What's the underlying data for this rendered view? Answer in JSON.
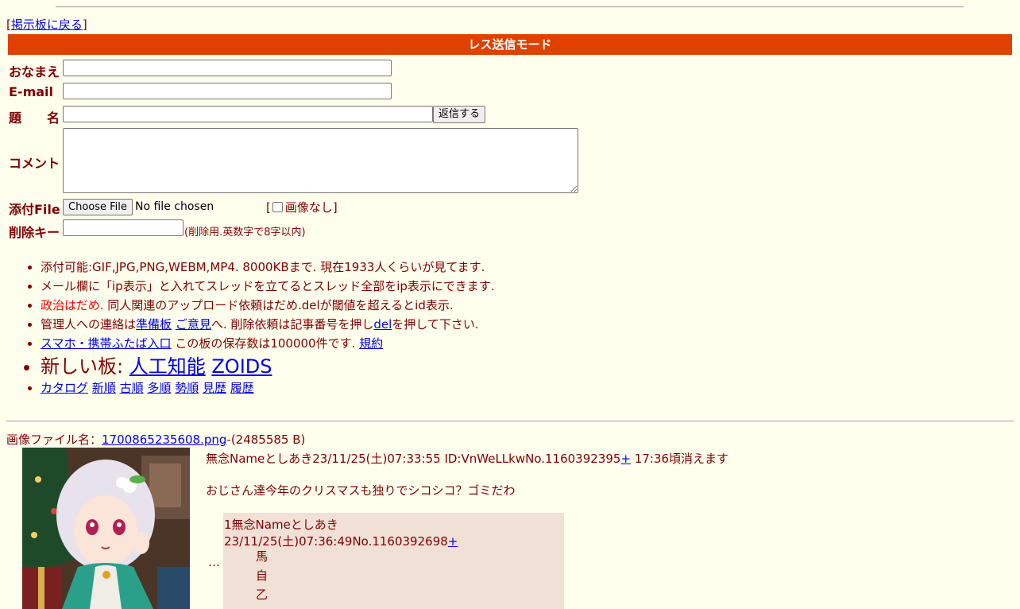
{
  "nav": {
    "back_open": "[",
    "back_label": "掲示板に戻る",
    "back_close": "]"
  },
  "form": {
    "mode_title": "レス送信モード",
    "name_label": "おなまえ",
    "email_label": "E-mail",
    "subject_label": "題　　名",
    "submit_label": "返信する",
    "comment_label": "コメント",
    "file_label": "添付File",
    "file_button": "Choose File",
    "file_status": "No file chosen",
    "noimage_open": "[",
    "noimage_label": "画像なし",
    "noimage_close": "]",
    "delkey_label": "削除キー",
    "delkey_hint": "(削除用.英数字で8字以内)"
  },
  "rules": {
    "r1": "添付可能:GIF,JPG,PNG,WEBM,MP4. 8000KBまで. 現在1933人くらいが見てます.",
    "r2": "メール欄に「ip表示」と入れてスレッドを立てるとスレッド全部をip表示にできます.",
    "r3_red": "政治はだめ.",
    "r3_rest": " 同人関連のアップロード依頼はだめ.delが閾値を超えるとid表示.",
    "r4_a": "管理人への連絡は",
    "r4_link1": "準備板",
    "r4_link2": "ご意見",
    "r4_b": "へ. 削除依頼は記事番号を押し",
    "r4_link3": "del",
    "r4_c": "を押して下さい.",
    "r5_link": "スマホ・携帯ふたば入口",
    "r5_text": " この板の保存数は100000件です.",
    "r5_link2": "規約",
    "r6_text": "新しい板: ",
    "r6_link1": "人工知能",
    "r6_link2": "ZOIDS",
    "sort_links": [
      "カタログ",
      "新順",
      "古順",
      "多順",
      "勢順",
      "見歴",
      "履歴"
    ]
  },
  "thread": {
    "file_prefix": "画像ファイル名：",
    "file_name": "1700865235608.png",
    "file_size": "-(2485585 B)",
    "op_header": "無念Nameとしあき23/11/25(土)07:33:55 ID:VnWeLLkwNo.1160392395",
    "op_plus": "+",
    "op_expire": " 17:36頃消えます",
    "op_body": "おじさん達今年のクリスマスも独りでシコシコ？ゴミだわ",
    "ellipsis": "…",
    "reply_header": "1無念Nameとしあき23/11/25(土)07:36:49No.1160392698",
    "reply_plus": "+",
    "reply_lines": [
      "馬",
      "自",
      "乙"
    ]
  },
  "colors": {
    "background": "#FFFFEE",
    "text": "#800000",
    "mode_bar": "#E04000",
    "reply_bg": "#F0E0D6",
    "link": "#0000EE"
  }
}
